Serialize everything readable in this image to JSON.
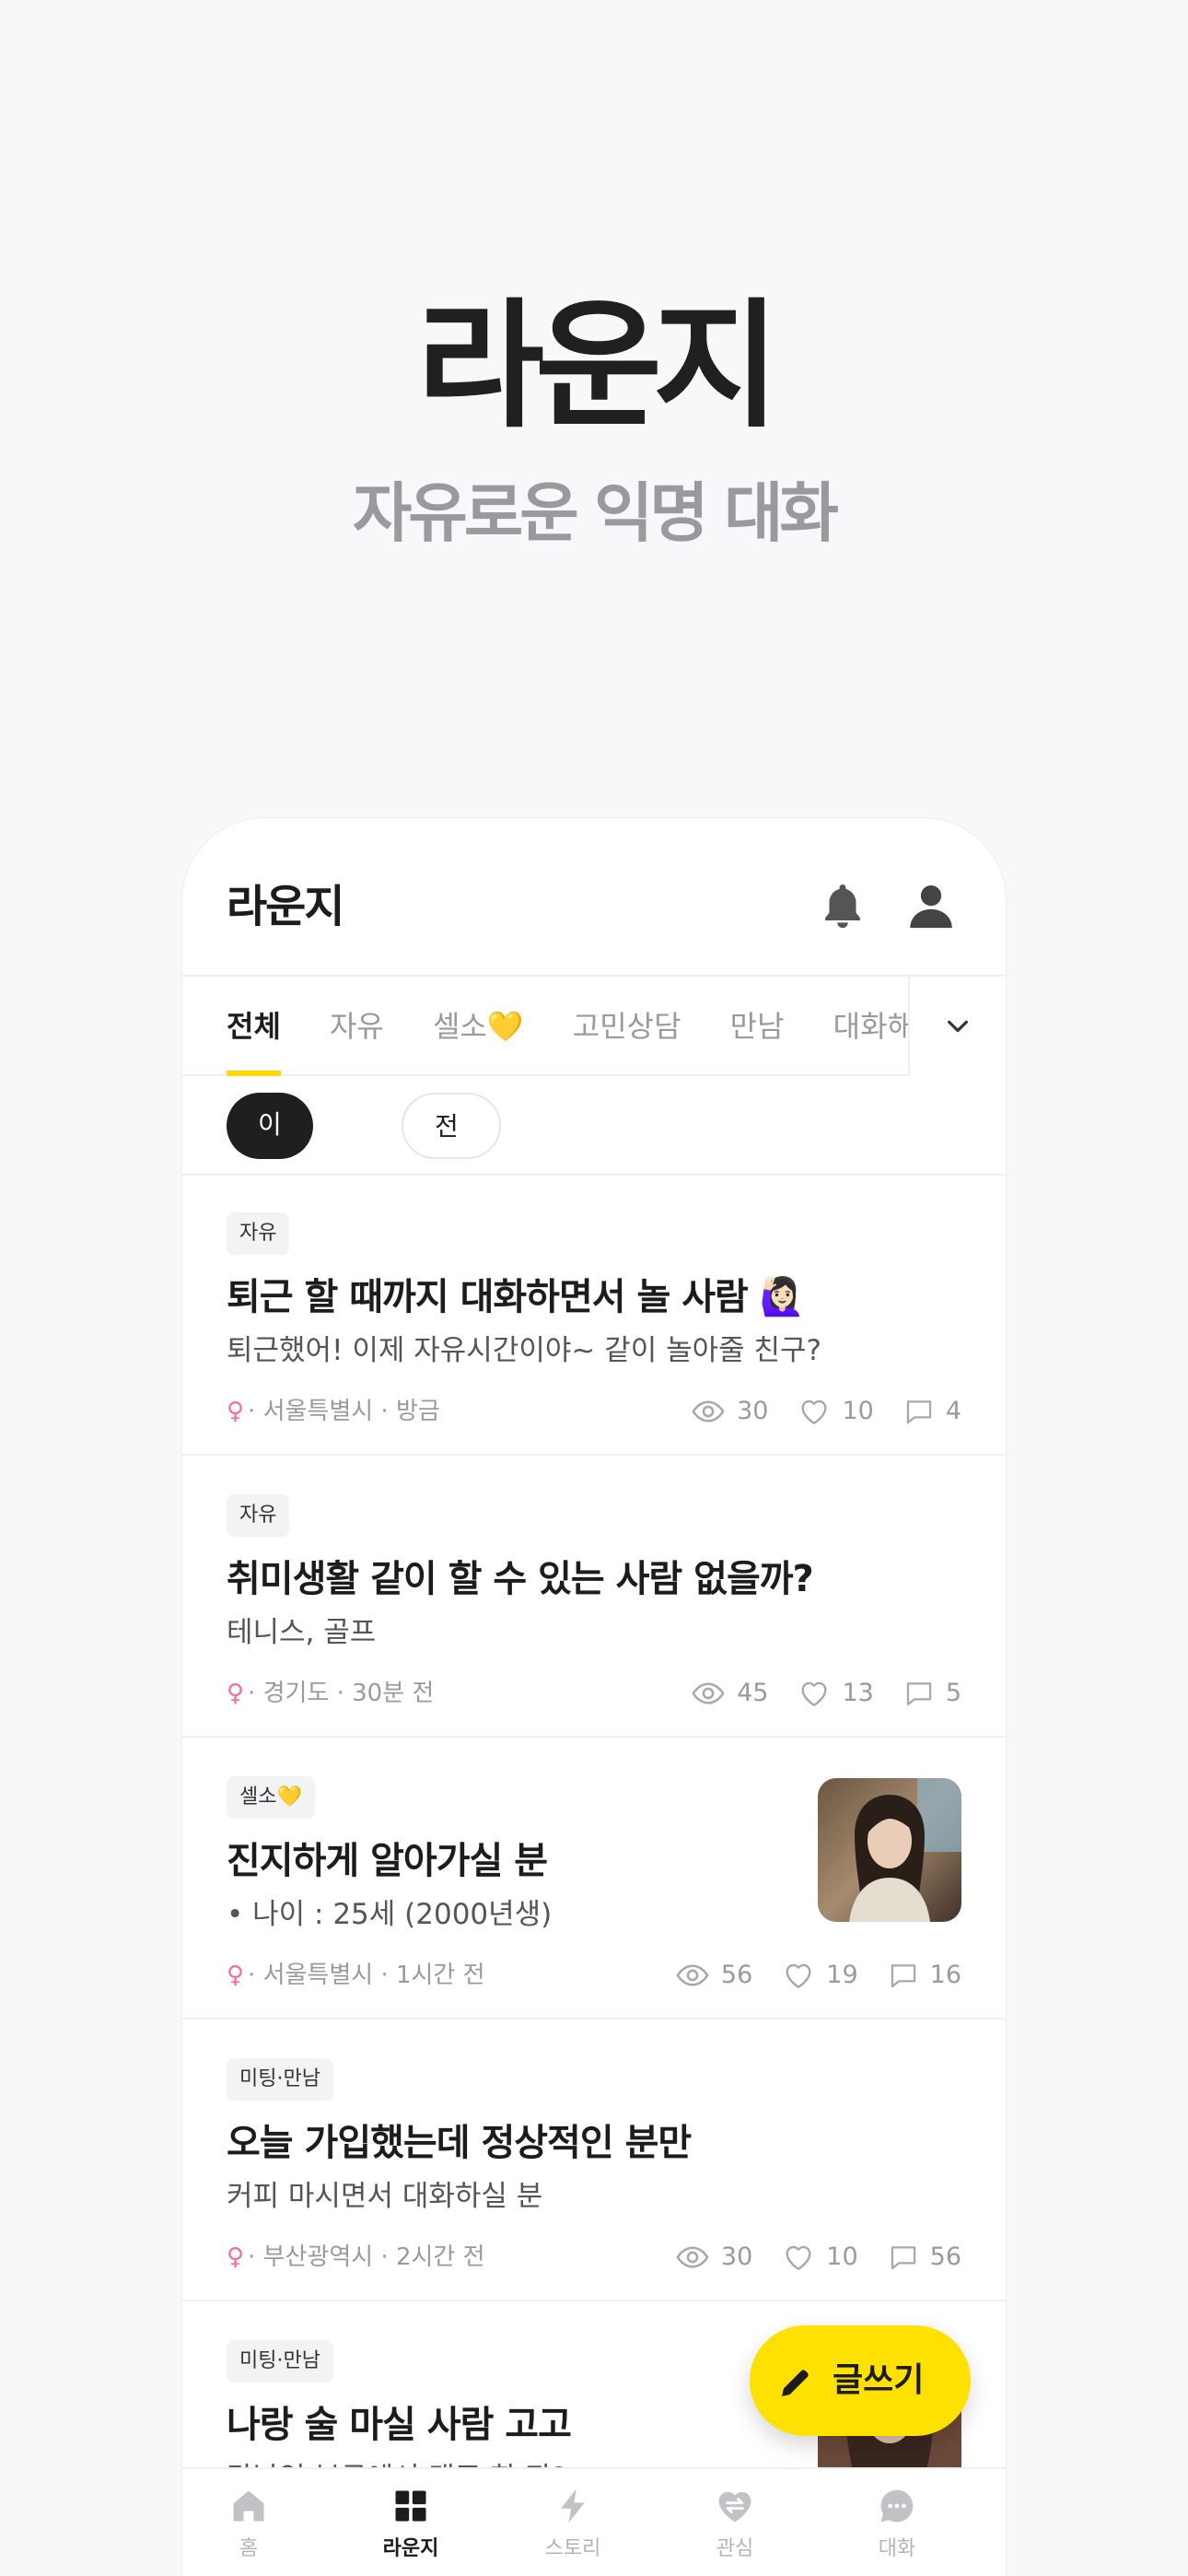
{
  "hero": {
    "title": "라운지",
    "subtitle": "자유로운 익명 대화"
  },
  "app": {
    "title": "라운지",
    "icons": [
      "bell-icon",
      "profile-icon"
    ]
  },
  "tabs": [
    "전체",
    "자유",
    "셀소💛",
    "고민상담",
    "만남",
    "대화해요"
  ],
  "active_tab": "전체",
  "filters": {
    "opposite_only": "이성 글만",
    "region": "전체 지역"
  },
  "posts": [
    {
      "category": "자유",
      "title": "퇴근 할 때까지 대화하면서 놀 사람 🙋🏻‍♀️",
      "body": "퇴근했어! 이제 자유시간이야~ 같이 놀아줄 친구?",
      "gender": "♀",
      "meta": "· 서울특별시 · 방금",
      "views": "30",
      "likes": "10",
      "comments": "4",
      "has_thumbnail": false
    },
    {
      "category": "자유",
      "title": "취미생활 같이 할 수 있는 사람 없을까?",
      "body": "테니스, 골프",
      "gender": "♀",
      "meta": "· 경기도 · 30분 전",
      "views": "45",
      "likes": "13",
      "comments": "5",
      "has_thumbnail": false
    },
    {
      "category": "셀소💛",
      "title": "진지하게 알아가실 분",
      "body": "• 나이 : 25세 (2000년생)",
      "gender": "♀",
      "meta": "· 서울특별시 · 1시간 전",
      "views": "56",
      "likes": "19",
      "comments": "16",
      "has_thumbnail": true
    },
    {
      "category": "미팅·만남",
      "title": "오늘 가입했는데 정상적인 분만",
      "body": "커피 마시면서 대화하실 분",
      "gender": "♀",
      "meta": "· 부산광역시 · 2시간 전",
      "views": "30",
      "likes": "10",
      "comments": "56",
      "has_thumbnail": false
    },
    {
      "category": "미팅·만남",
      "title": "나랑 술 마실 사람 고고",
      "body": "강남역 부근에서 맥주 한 잔?",
      "has_thumbnail": true
    }
  ],
  "fab": {
    "label": "글쓰기"
  },
  "bottom_nav": [
    {
      "label": "홈",
      "icon": "home-icon"
    },
    {
      "label": "라운지",
      "icon": "grid-icon"
    },
    {
      "label": "스토리",
      "icon": "lightning-icon"
    },
    {
      "label": "관심",
      "icon": "heart-exchange-icon"
    },
    {
      "label": "대화",
      "icon": "chat-icon"
    }
  ],
  "active_nav": "라운지",
  "colors": {
    "accent": "#ffd60a",
    "fab": "#ffe100",
    "female": "#f06ea0",
    "chip_dark": "#1f1f1f"
  }
}
